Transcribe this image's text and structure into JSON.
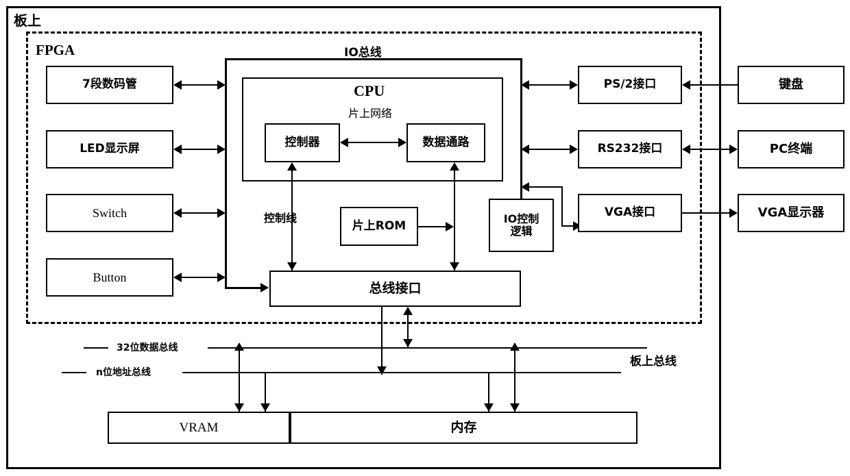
{
  "diagram": {
    "outer_frame_label": "板上",
    "fpga_frame_label": "FPGA",
    "io_bus_label": "IO总线",
    "board_bus_label": "板上总线",
    "control_line_label": "控制线",
    "data_bus_label": "32位数据总线",
    "address_bus_label": "n位地址总线"
  },
  "peripherals_left": [
    {
      "label": "7段数码管"
    },
    {
      "label": "LED显示屏"
    },
    {
      "label": "Switch"
    },
    {
      "label": "Button"
    }
  ],
  "cpu": {
    "title": "CPU",
    "noc_label": "片上网络",
    "controller_label": "控制器",
    "datapath_label": "数据通路"
  },
  "on_chip": {
    "rom_label": "片上ROM",
    "io_control_logic_label": "IO控制\n逻辑",
    "bus_interface_label": "总线接口"
  },
  "interfaces": [
    {
      "label": "PS/2接口"
    },
    {
      "label": "RS232接口"
    },
    {
      "label": "VGA接口"
    }
  ],
  "externals": [
    {
      "label": "键盘"
    },
    {
      "label": "PC终端"
    },
    {
      "label": "VGA显示器"
    }
  ],
  "memories": [
    {
      "label": "VRAM"
    },
    {
      "label": "内存"
    }
  ],
  "colors": {
    "stroke": "#000000",
    "background": "#ffffff"
  }
}
